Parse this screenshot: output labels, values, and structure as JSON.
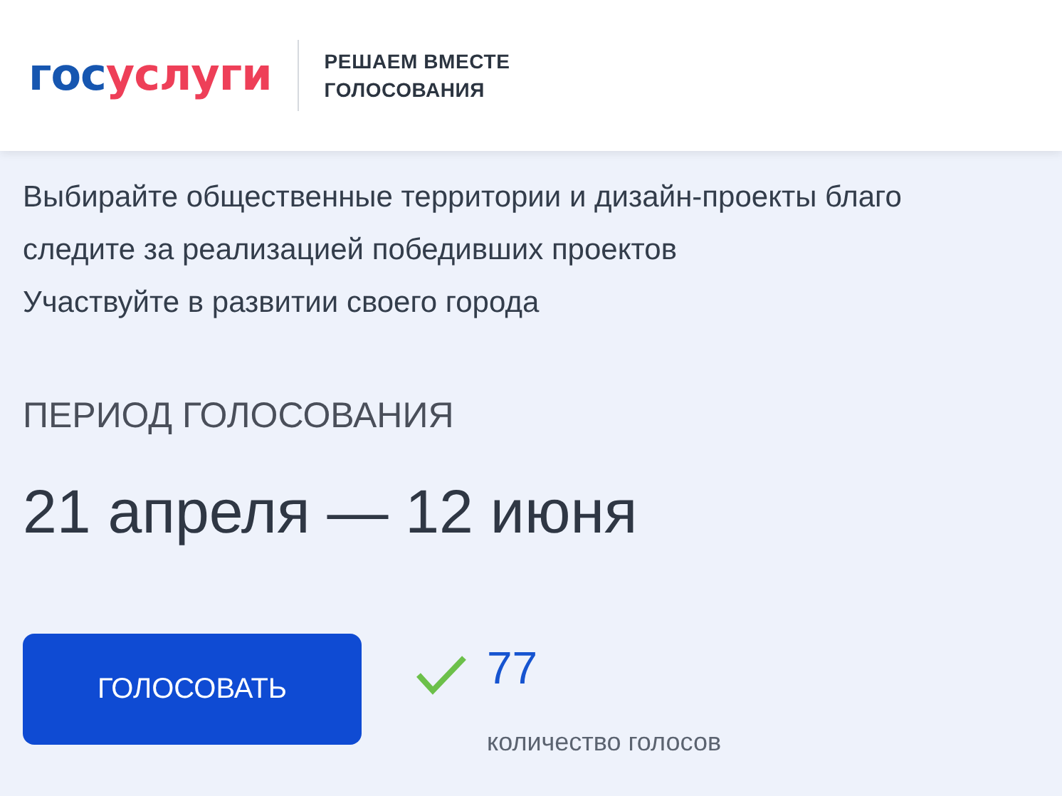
{
  "header": {
    "logo": [
      {
        "text": "гос",
        "color": "#1656b0"
      },
      {
        "text": "услуги",
        "color": "#ee3f58"
      }
    ],
    "tagline": [
      "РЕШАЕМ ВМЕСТЕ",
      "ГОЛОСОВАНИЯ"
    ]
  },
  "intro": [
    "Выбирайте общественные территории и дизайн-проекты благо",
    "следите за реализацией победивших проектов",
    "Участвуйте в развитии своего города"
  ],
  "period": {
    "label": "ПЕРИОД ГОЛОСОВАНИЯ",
    "dates": "21 апреля — 12 июня"
  },
  "vote": {
    "button": "ГОЛОСОВАТЬ",
    "count": "77",
    "caption": "количество голосов"
  }
}
